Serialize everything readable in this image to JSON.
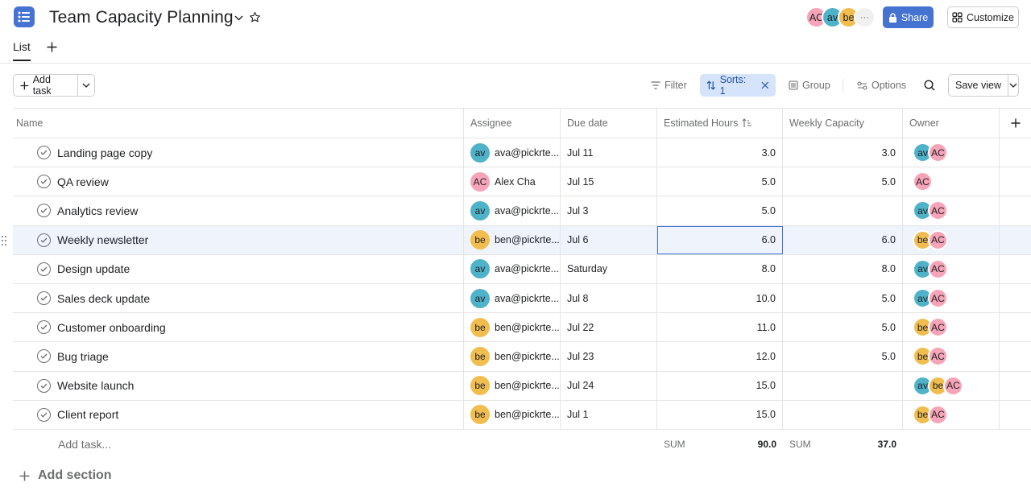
{
  "header": {
    "title": "Team Capacity Planning",
    "avatars": [
      {
        "initials": "AC",
        "color": "#f8a4b8"
      },
      {
        "initials": "av",
        "color": "#4eb2c8"
      },
      {
        "initials": "be",
        "color": "#f1bd4e"
      }
    ],
    "more_label": "···",
    "share_label": "Share",
    "customize_label": "Customize"
  },
  "tabs": {
    "list_label": "List"
  },
  "toolbar": {
    "add_task_label": "Add task",
    "filter_label": "Filter",
    "sorts_label": "Sorts: 1",
    "group_label": "Group",
    "options_label": "Options",
    "save_view_label": "Save view"
  },
  "columns": {
    "name": "Name",
    "assignee": "Assignee",
    "due": "Due date",
    "est": "Estimated Hours",
    "weekly": "Weekly Capacity",
    "owner": "Owner"
  },
  "rows": [
    {
      "name": "Landing page copy",
      "assignee": "ava@pickrte...",
      "assignee_initials": "av",
      "due": "Jul 11",
      "est": "3.0",
      "weekly": "3.0",
      "owners": [
        "av",
        "AC"
      ]
    },
    {
      "name": "QA review",
      "assignee": "Alex Cha",
      "assignee_initials": "AC",
      "due": "Jul 15",
      "est": "5.0",
      "weekly": "5.0",
      "owners": [
        "AC"
      ]
    },
    {
      "name": "Analytics review",
      "assignee": "ava@pickrte...",
      "assignee_initials": "av",
      "due": "Jul 3",
      "est": "5.0",
      "weekly": "",
      "owners": [
        "av",
        "AC"
      ]
    },
    {
      "name": "Weekly newsletter",
      "assignee": "ben@pickrte...",
      "assignee_initials": "be",
      "due": "Jul 6",
      "est": "6.0",
      "weekly": "6.0",
      "owners": [
        "be",
        "AC"
      ]
    },
    {
      "name": "Design update",
      "assignee": "ava@pickrte...",
      "assignee_initials": "av",
      "due": "Saturday",
      "est": "8.0",
      "weekly": "8.0",
      "owners": [
        "av",
        "AC"
      ]
    },
    {
      "name": "Sales deck update",
      "assignee": "ava@pickrte...",
      "assignee_initials": "av",
      "due": "Jul 8",
      "est": "10.0",
      "weekly": "5.0",
      "owners": [
        "av",
        "AC"
      ]
    },
    {
      "name": "Customer onboarding",
      "assignee": "ben@pickrte...",
      "assignee_initials": "be",
      "due": "Jul 22",
      "est": "11.0",
      "weekly": "5.0",
      "owners": [
        "be",
        "AC"
      ]
    },
    {
      "name": "Bug triage",
      "assignee": "ben@pickrte...",
      "assignee_initials": "be",
      "due": "Jul 23",
      "est": "12.0",
      "weekly": "5.0",
      "owners": [
        "be",
        "AC"
      ]
    },
    {
      "name": "Website launch",
      "assignee": "ben@pickrte...",
      "assignee_initials": "be",
      "due": "Jul 24",
      "est": "15.0",
      "weekly": "",
      "owners": [
        "av",
        "be",
        "AC"
      ]
    },
    {
      "name": "Client report",
      "assignee": "ben@pickrte...",
      "assignee_initials": "be",
      "due": "Jul 1",
      "est": "15.0",
      "weekly": "",
      "owners": [
        "be",
        "AC"
      ]
    }
  ],
  "footer": {
    "add_task_placeholder": "Add task...",
    "sum_label": "SUM",
    "est_sum": "90.0",
    "weekly_sum": "37.0"
  },
  "add_section_label": "Add section",
  "colors": {
    "accent": "#4573d2",
    "selected_row": "#eef3fc",
    "sort_chip": "#d6e4fb"
  }
}
